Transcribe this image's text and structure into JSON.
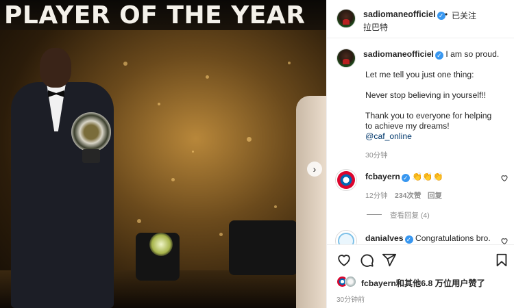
{
  "photo": {
    "banner_text": "PLAYER OF THE YEAR",
    "next_arrow": "›"
  },
  "post": {
    "header": {
      "username": "sadiomaneofficiel",
      "verified_mark": "✓",
      "separator": "•",
      "follow_status": "已关注",
      "location": "拉巴特",
      "more": "···"
    },
    "caption": {
      "username": "sadiomaneofficiel",
      "lines": [
        "I am so proud.",
        "Let me tell you just one thing:",
        "Never stop believing in yourself!!",
        "Thank you to everyone for helping",
        "to achieve my dreams!"
      ],
      "mention": "@caf_online",
      "time": "30分钟"
    },
    "comments": [
      {
        "username": "fcbayern",
        "text": "👏👏👏",
        "time": "12分钟",
        "likes": "234次赞",
        "reply": "回复",
        "view_replies": "查看回复 (4)"
      },
      {
        "username": "danialves",
        "text": "Congratulations bro."
      }
    ],
    "likes_summary": "fcbayern和其他6.8 万位用户赞了",
    "timestamp": "30分钟前"
  },
  "colors": {
    "link": "#00376b",
    "verified": "#3897f0",
    "muted": "#8e8e8e"
  },
  "icons": [
    "heart-icon",
    "comment-icon",
    "share-icon",
    "bookmark-icon",
    "verified-icon",
    "more-icon"
  ]
}
